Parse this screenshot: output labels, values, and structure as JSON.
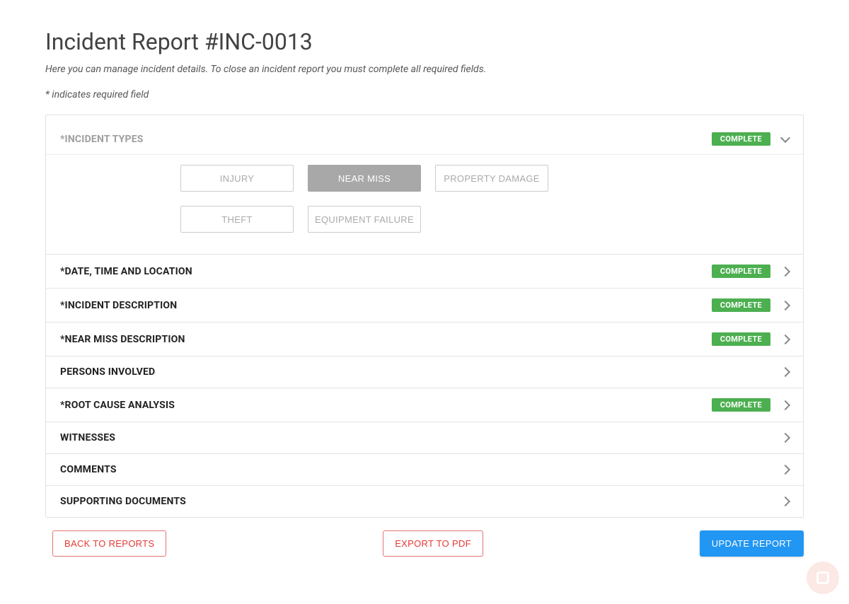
{
  "header": {
    "title": "Incident Report #INC-0013",
    "subtitle": "Here you can manage incident details. To close an incident report you must complete all required fields.",
    "required_note": "* indicates required field"
  },
  "badge_text": "COMPLETE",
  "incident_types": {
    "title": "*INCIDENT TYPES",
    "options": [
      {
        "label": "INJURY",
        "selected": false
      },
      {
        "label": "NEAR MISS",
        "selected": true
      },
      {
        "label": "PROPERTY DAMAGE",
        "selected": false
      },
      {
        "label": "THEFT",
        "selected": false
      },
      {
        "label": "EQUIPMENT FAILURE",
        "selected": false
      }
    ]
  },
  "sections": [
    {
      "title": "*DATE, TIME AND LOCATION",
      "complete": true
    },
    {
      "title": "*INCIDENT DESCRIPTION",
      "complete": true
    },
    {
      "title": "*NEAR MISS DESCRIPTION",
      "complete": true
    },
    {
      "title": "PERSONS INVOLVED",
      "complete": false
    },
    {
      "title": "*ROOT CAUSE ANALYSIS",
      "complete": true
    },
    {
      "title": "WITNESSES",
      "complete": false
    },
    {
      "title": "COMMENTS",
      "complete": false
    },
    {
      "title": "SUPPORTING DOCUMENTS",
      "complete": false
    }
  ],
  "actions": {
    "back": "BACK TO REPORTS",
    "export": "EXPORT TO PDF",
    "update": "UPDATE REPORT"
  }
}
